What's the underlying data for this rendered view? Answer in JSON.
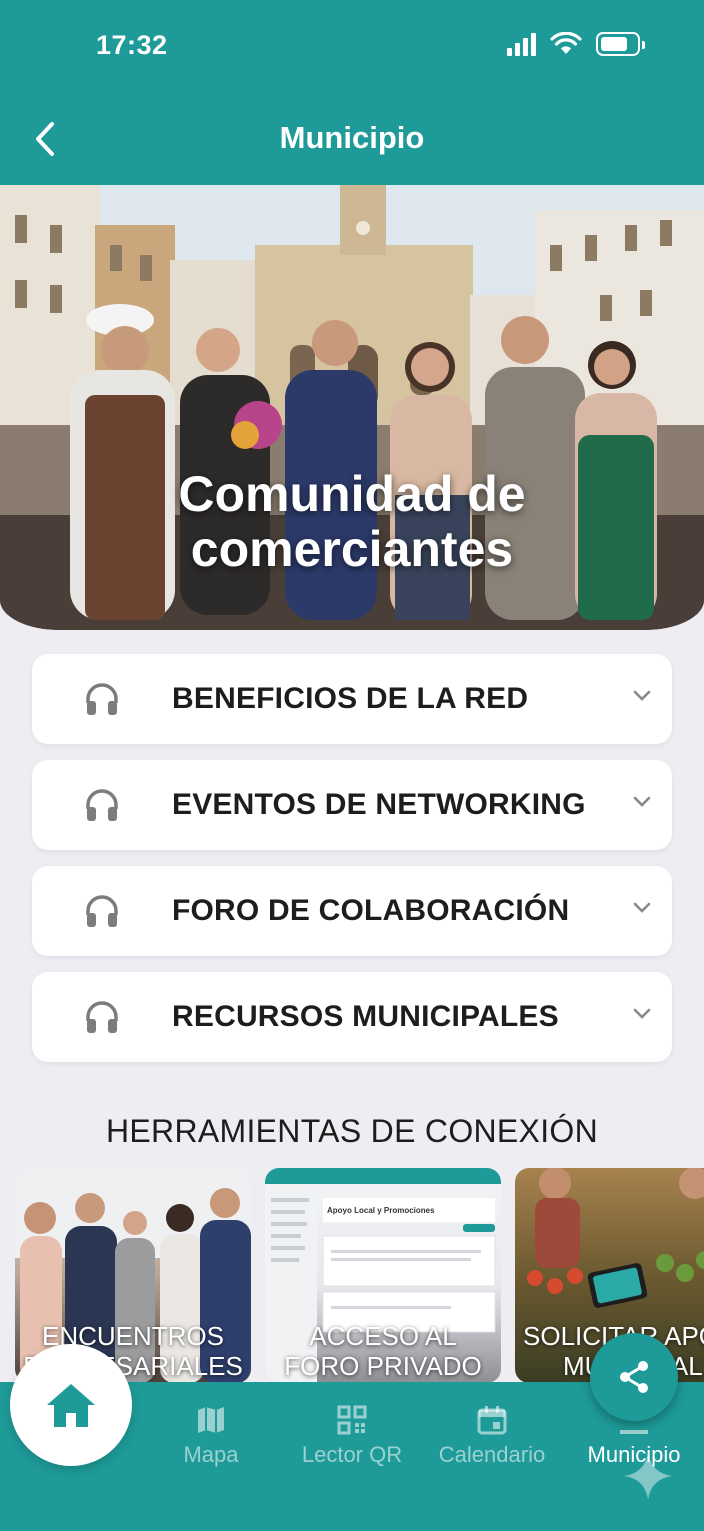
{
  "status_bar": {
    "time": "17:32"
  },
  "header": {
    "title": "Municipio"
  },
  "hero": {
    "title_line1": "Comunidad de",
    "title_line2": "comerciantes"
  },
  "accordion": [
    {
      "label": "BENEFICIOS DE LA RED",
      "icon": "headphones-icon"
    },
    {
      "label": "EVENTOS DE NETWORKING",
      "icon": "headphones-icon"
    },
    {
      "label": "FORO DE COLABORACIÓN",
      "icon": "headphones-icon"
    },
    {
      "label": "RECURSOS MUNICIPALES",
      "icon": "headphones-icon"
    }
  ],
  "tools": {
    "title": "HERRAMIENTAS DE CONEXIÓN",
    "cards": [
      {
        "line1": "ENCUENTROS",
        "line2": "EMPRESARIALES"
      },
      {
        "line1": "ACCESO AL",
        "line2": "FORO PRIVADO",
        "screen_title": "Apoyo Local y Promociones"
      },
      {
        "line1": "SOLICITAR APOYO",
        "line2": "MUNICIPAL"
      }
    ]
  },
  "bottom_nav": {
    "items": [
      {
        "label": "Mapa",
        "icon": "map-icon"
      },
      {
        "label": "Lector QR",
        "icon": "qr-code-icon"
      },
      {
        "label": "Calendario",
        "icon": "calendar-icon"
      },
      {
        "label": "Municipio",
        "icon": "building-icon"
      }
    ],
    "home_icon": "home-icon",
    "share_icon": "share-icon"
  },
  "colors": {
    "primary": "#1e9a98",
    "background": "#ededf2",
    "text": "#1d1d1d"
  }
}
